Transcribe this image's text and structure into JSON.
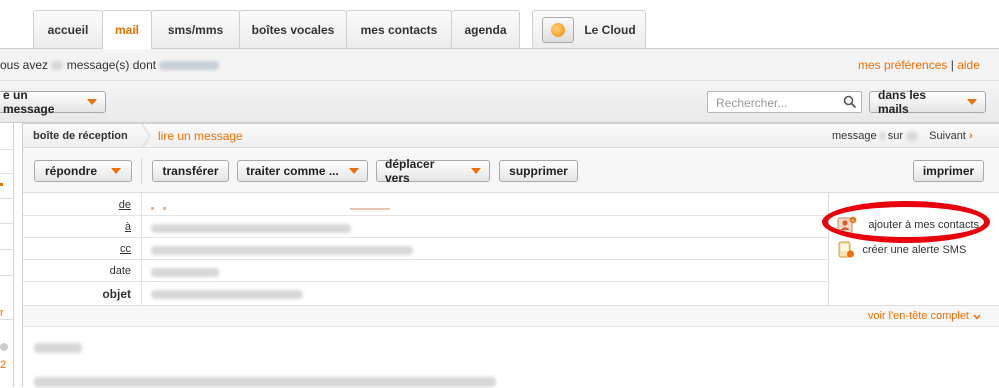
{
  "tabs": [
    {
      "label": "accueil",
      "active": false
    },
    {
      "label": "mail",
      "active": true
    },
    {
      "label": "sms/mms",
      "active": false
    },
    {
      "label": "boîtes vocales",
      "active": false
    },
    {
      "label": "mes contacts",
      "active": false
    },
    {
      "label": "agenda",
      "active": false
    },
    {
      "label": "Le Cloud",
      "active": false
    }
  ],
  "status": {
    "prefix": "ous avez",
    "middle": "message(s) dont"
  },
  "links": {
    "preferences": "mes préférences",
    "separator": "|",
    "help": "aide"
  },
  "toolbar": {
    "write_label": "e un message",
    "search_placeholder": "Rechercher...",
    "scope_label": "dans les mails"
  },
  "breadcrumb": {
    "inbox": "boîte de réception",
    "current": "lire un message"
  },
  "pager": {
    "message": "message",
    "dot": ".",
    "of": "sur",
    "next": "Suivant",
    "next_arrow": "›"
  },
  "actions": {
    "reply": "répondre",
    "forward": "transférer",
    "treat_as": "traiter comme ...",
    "move_to": "déplacer vers",
    "delete": "supprimer",
    "print": "imprimer"
  },
  "header_fields": {
    "from": "de",
    "to": "à",
    "cc": "cc",
    "date": "date",
    "subject": "objet"
  },
  "side_actions": {
    "add_contact": "ajouter à mes contacts",
    "sms_alert": "créer une alerte SMS"
  },
  "full_header_link": "voir l'en-tête complet",
  "sidebar_fragments": {
    "r": "r",
    "two": "2"
  },
  "colors": {
    "accent": "#f16e00",
    "highlight": "#e8000b"
  }
}
